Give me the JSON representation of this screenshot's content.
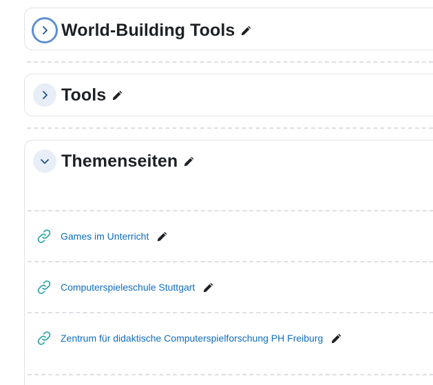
{
  "sections": [
    {
      "title": "World-Building Tools",
      "state": "collapsed",
      "toggle_icon": "chevron-right-icon",
      "edit_icon": "pencil-icon"
    },
    {
      "title": "Tools",
      "state": "collapsed",
      "toggle_icon": "chevron-right-icon",
      "edit_icon": "pencil-icon"
    },
    {
      "title": "Themenseiten",
      "state": "expanded",
      "toggle_icon": "chevron-down-icon",
      "edit_icon": "pencil-icon",
      "activities": [
        {
          "label": "Games im Unterricht",
          "icon": "link-icon"
        },
        {
          "label": "Computerspieleschule Stuttgart",
          "icon": "link-icon"
        },
        {
          "label": "Zentrum für didaktische Computerspielforschung PH Freiburg",
          "icon": "link-icon"
        }
      ]
    }
  ],
  "colors": {
    "link": "#0f6cbf",
    "link_icon": "#2aa3a3",
    "toggle_bg": "#e7eef7",
    "focus_ring": "#5b8fcf",
    "border": "#dee2e6"
  }
}
